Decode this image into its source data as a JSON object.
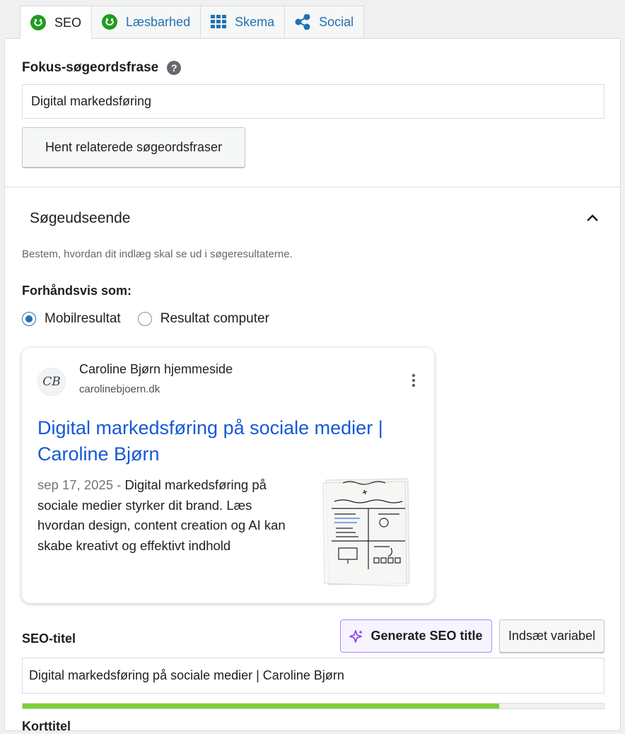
{
  "tabs": [
    {
      "label": "SEO",
      "icon": "smiley-good-icon"
    },
    {
      "label": "Læsbarhed",
      "icon": "smiley-good-icon"
    },
    {
      "label": "Skema",
      "icon": "grid-icon"
    },
    {
      "label": "Social",
      "icon": "share-icon"
    }
  ],
  "focus": {
    "label": "Fokus-søgeordsfrase",
    "help": "?",
    "value": "Digital markedsføring",
    "related_button": "Hent relaterede søgeordsfraser"
  },
  "search_appearance": {
    "title": "Søgeudseende",
    "description": "Bestem, hvordan dit indlæg skal se ud i søgeresultaterne.",
    "preview_label": "Forhåndsvis som:",
    "options": [
      {
        "label": "Mobilresultat",
        "checked": true
      },
      {
        "label": "Resultat computer",
        "checked": false
      }
    ]
  },
  "google_preview": {
    "site_name": "Caroline Bjørn hjemmeside",
    "url": "carolinebjoern.dk",
    "favicon_text": "CB",
    "title": "Digital markedsføring på sociale medier | Caroline Bjørn",
    "date": "sep 17, 2025",
    "separator": " - ",
    "snippet": "Digital markedsføring på sociale medier styrker dit brand. Læs hvordan design, content creation og AI kan skabe kreativt og effektivt indhold",
    "title_color": "#1558d6"
  },
  "seo_title": {
    "label": "SEO-titel",
    "generate_button": "Generate SEO title",
    "insert_variable_button": "Indsæt variabel",
    "value": "Digital markedsføring på sociale medier | Caroline Bjørn",
    "progress_percent": 82,
    "progress_color": "#7ad03a"
  },
  "next_field_label": "Korttitel"
}
